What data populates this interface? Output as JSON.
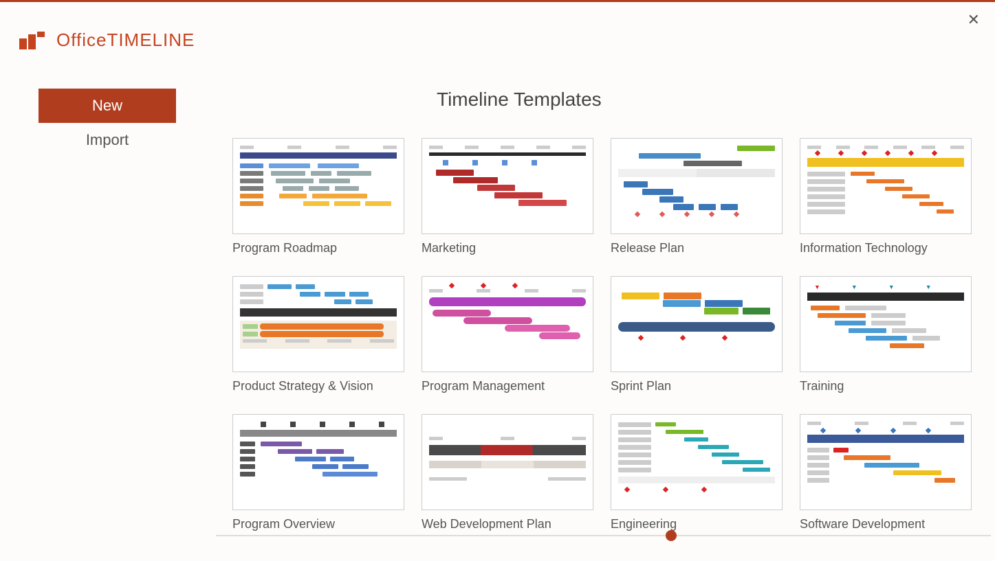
{
  "brand": {
    "first": "Office",
    "second": "TIMELINE"
  },
  "close_label": "✕",
  "nav": {
    "new": "New",
    "import": "Import"
  },
  "section_title": "Timeline Templates",
  "templates": [
    {
      "label": "Program Roadmap"
    },
    {
      "label": "Marketing"
    },
    {
      "label": "Release Plan"
    },
    {
      "label": "Information Technology"
    },
    {
      "label": "Product Strategy & Vision"
    },
    {
      "label": "Program Management"
    },
    {
      "label": "Sprint Plan"
    },
    {
      "label": "Training"
    },
    {
      "label": "Program Overview"
    },
    {
      "label": "Web Development Plan"
    },
    {
      "label": "Engineering"
    },
    {
      "label": "Software Development"
    }
  ]
}
